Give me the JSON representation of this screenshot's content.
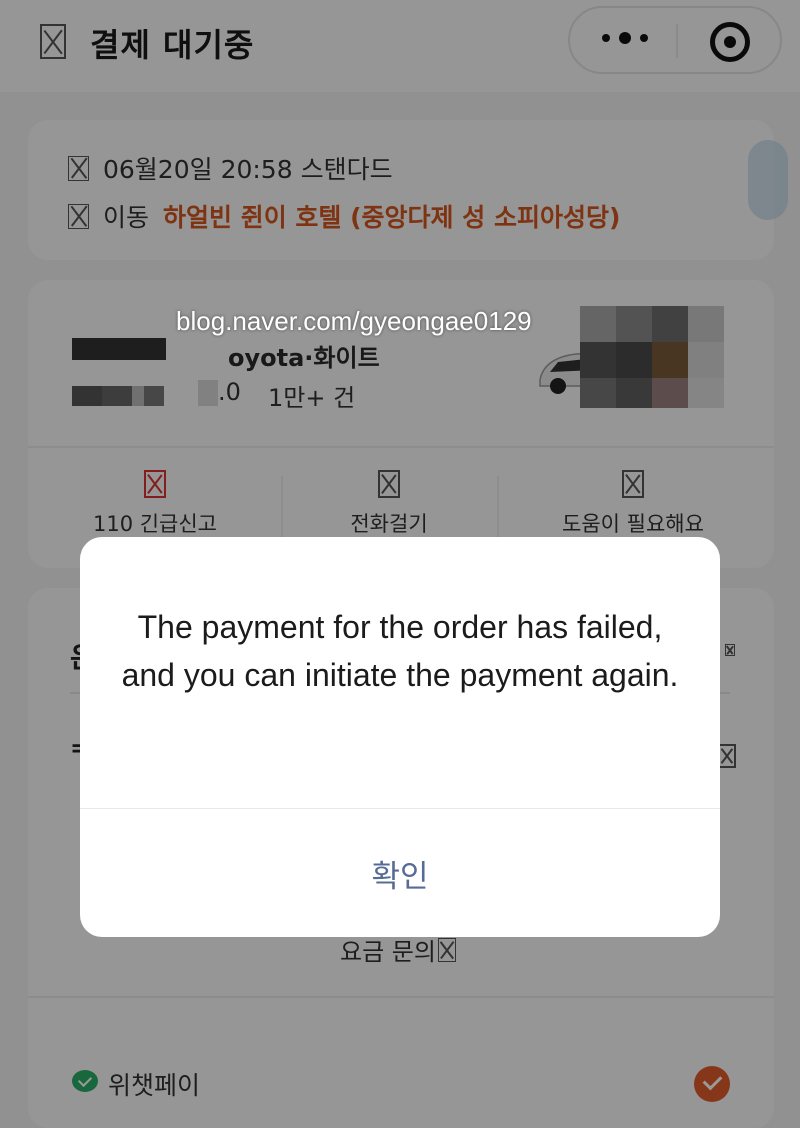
{
  "header": {
    "title": "결제 대기중"
  },
  "trip": {
    "time_text": "06월20일 20:58 스탠다드",
    "move_label": "이동",
    "destination": "하얼빈 쥔이 호텔 (중앙다제 성 소피아성당)"
  },
  "driver": {
    "car_model": "oyota·화이트",
    "rating": ".0",
    "trips": "1만+ 건"
  },
  "actions": [
    {
      "label": "110 긴급신고"
    },
    {
      "label": "전화걸기"
    },
    {
      "label": "도움이 필요해요"
    }
  ],
  "payment": {
    "partial_heading": "은",
    "partial_row": "=",
    "inquiry_label": "요금 문의",
    "method_label": "위챗페이"
  },
  "watermark": "blog.naver.com/gyeongae0129",
  "modal": {
    "message": "The payment for the order has failed, and you can initiate the payment again.",
    "confirm_label": "확인"
  },
  "colors": {
    "accent_orange": "#d2581f",
    "confirm_blue": "#566c95",
    "wechat_green": "#2aae67",
    "check_orange": "#e05a2b"
  }
}
